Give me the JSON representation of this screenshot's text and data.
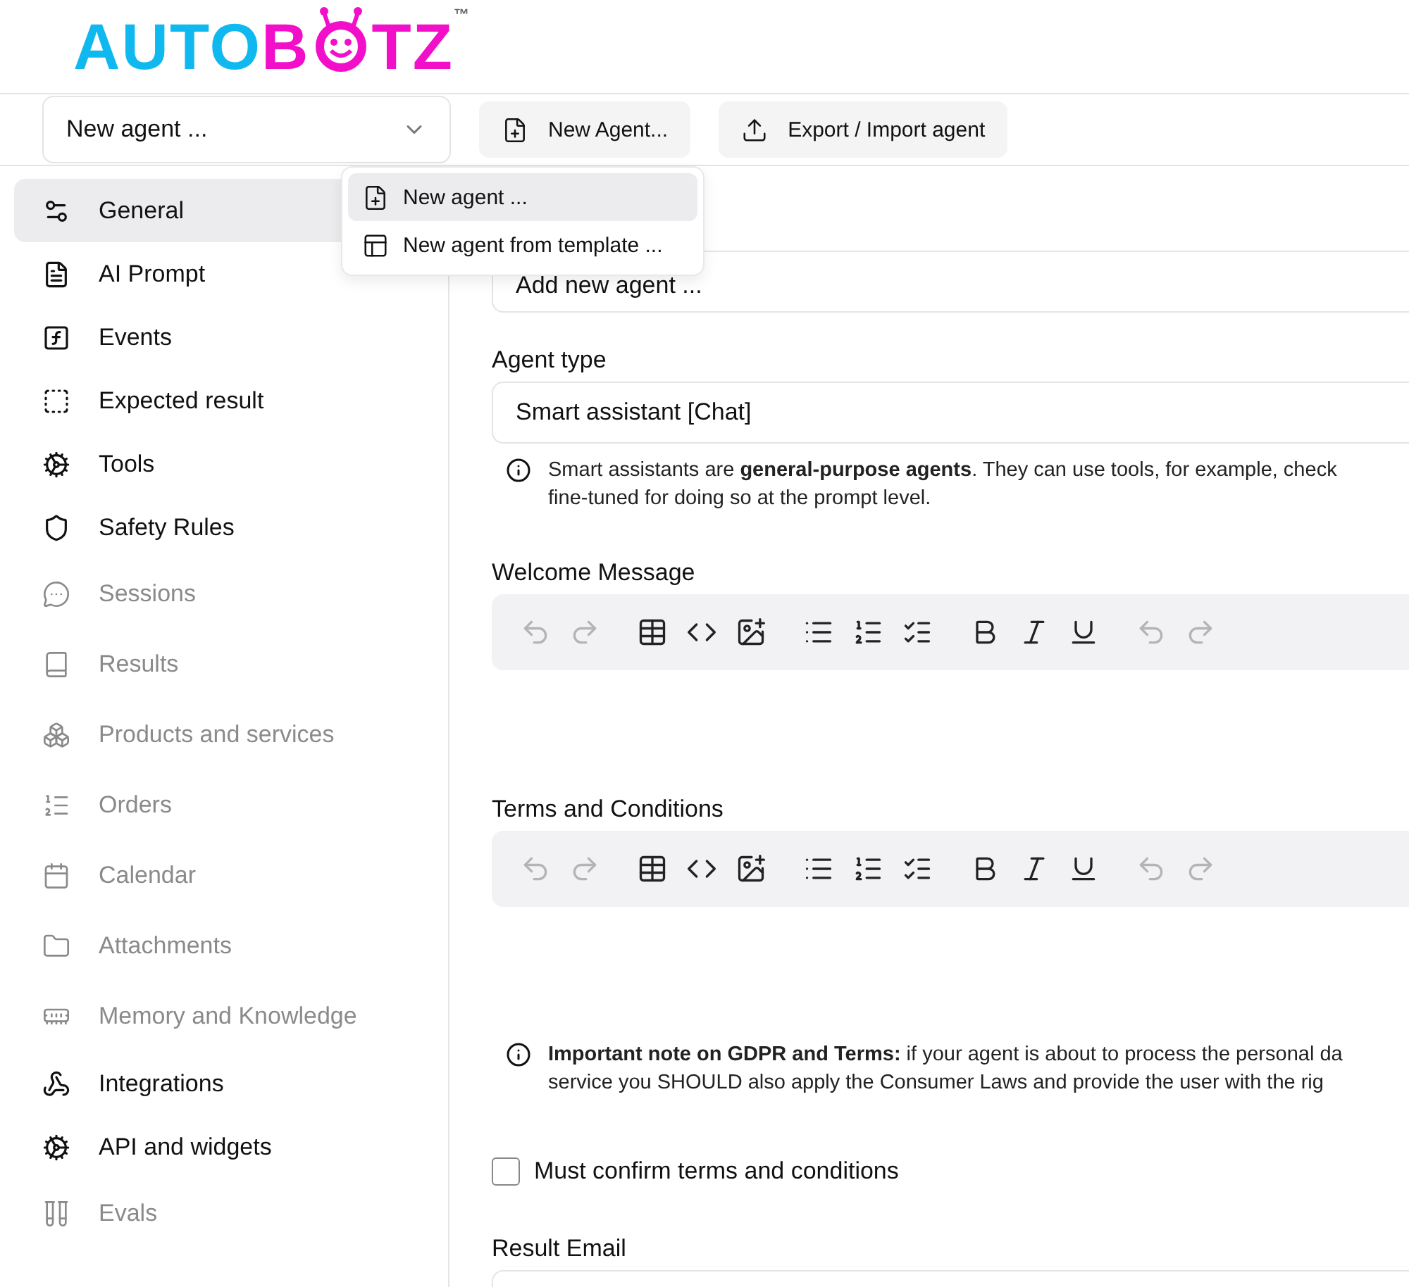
{
  "logo": {
    "first": "AUTO",
    "second_left": "B",
    "second_right": "TZ",
    "trademark": "™"
  },
  "toolbar": {
    "agent_select": {
      "value": "New agent ..."
    },
    "buttons": [
      {
        "kind": "new",
        "label": "New Agent..."
      },
      {
        "kind": "export",
        "label": "Export / Import agent"
      }
    ]
  },
  "new_menu": {
    "items": [
      {
        "kind": "new",
        "label": "New agent ...",
        "selected": true
      },
      {
        "kind": "template",
        "label": "New agent from template ...",
        "selected": false
      }
    ]
  },
  "sidebar": {
    "items": [
      {
        "label": "General",
        "selected": true,
        "disabled": false
      },
      {
        "label": "AI Prompt",
        "selected": false,
        "disabled": false
      },
      {
        "label": "Events",
        "selected": false,
        "disabled": false
      },
      {
        "label": "Expected result",
        "selected": false,
        "disabled": false
      },
      {
        "label": "Tools",
        "selected": false,
        "disabled": false
      },
      {
        "label": "Safety Rules",
        "selected": false,
        "disabled": false
      },
      {
        "label": "Sessions",
        "selected": false,
        "disabled": true
      },
      {
        "label": "Results",
        "selected": false,
        "disabled": true
      },
      {
        "label": "Products and services",
        "selected": false,
        "disabled": true
      },
      {
        "label": "Orders",
        "selected": false,
        "disabled": true
      },
      {
        "label": "Calendar",
        "selected": false,
        "disabled": true
      },
      {
        "label": "Attachments",
        "selected": false,
        "disabled": true
      },
      {
        "label": "Memory and Knowledge",
        "selected": false,
        "disabled": true
      },
      {
        "label": "Integrations",
        "selected": false,
        "disabled": false
      },
      {
        "label": "API and widgets",
        "selected": false,
        "disabled": false
      },
      {
        "label": "Evals",
        "selected": false,
        "disabled": true
      }
    ]
  },
  "form": {
    "name_field": {
      "value": "Add new agent ..."
    },
    "agent_type": {
      "label": "Agent type",
      "value": "Smart assistant [Chat]",
      "note": [
        "Smart assistants are **general-purpose agents**. They can use tools, for example, check",
        "fine-tuned for doing so at the prompt level."
      ]
    },
    "editors": [
      {
        "label": "Welcome Message"
      },
      {
        "label": "Terms and Conditions"
      }
    ],
    "editor_toolbar": [
      [
        {
          "kind": "undo",
          "disabled": true
        },
        {
          "kind": "redo",
          "disabled": true
        }
      ],
      [
        {
          "kind": "table",
          "disabled": false
        },
        {
          "kind": "code",
          "disabled": false
        },
        {
          "kind": "image",
          "disabled": false
        }
      ],
      [
        {
          "kind": "bullets",
          "disabled": false
        },
        {
          "kind": "numbered",
          "disabled": false
        },
        {
          "kind": "checklist",
          "disabled": false
        }
      ],
      [
        {
          "kind": "bold",
          "disabled": false
        },
        {
          "kind": "italic",
          "disabled": false
        },
        {
          "kind": "underline",
          "disabled": false
        }
      ],
      [
        {
          "kind": "undo",
          "disabled": true
        },
        {
          "kind": "redo",
          "disabled": true
        }
      ]
    ],
    "gdpr_note": [
      "**Important note on GDPR and Terms:** if your agent is about to process the personal da",
      "service you SHOULD also apply the Consumer Laws and provide the user with the rig"
    ],
    "confirm_terms": {
      "label": "Must confirm terms and conditions",
      "checked": false
    },
    "result_email": {
      "label": "Result Email"
    }
  }
}
